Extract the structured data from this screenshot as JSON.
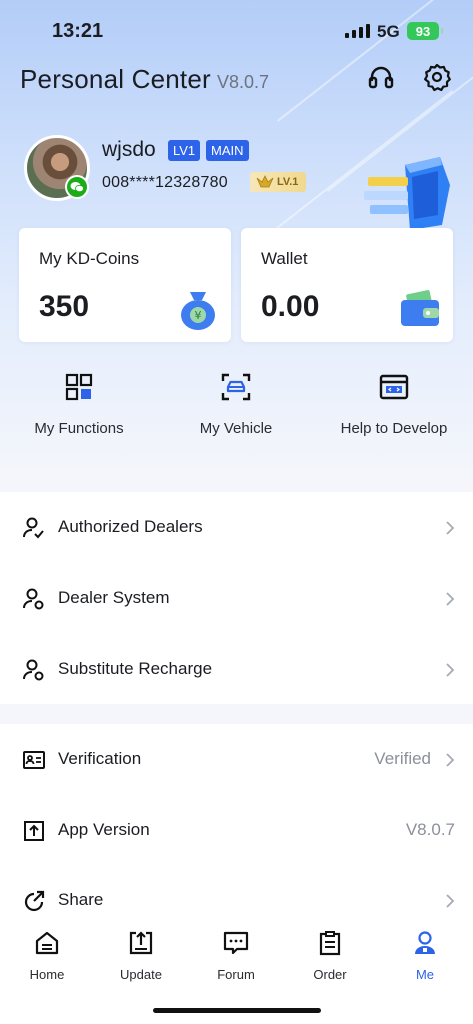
{
  "status": {
    "time": "13:21",
    "network": "5G",
    "battery": "93"
  },
  "header": {
    "title": "Personal Center",
    "version": "V8.0.7"
  },
  "profile": {
    "username": "wjsdo",
    "level_tag": "LV1",
    "account_tag": "MAIN",
    "phone": "008****12328780",
    "vip_level": "LV.1"
  },
  "cards": {
    "coins": {
      "label": "My KD-Coins",
      "value": "350"
    },
    "wallet": {
      "label": "Wallet",
      "value": "0.00"
    }
  },
  "quick": [
    {
      "label": "My Functions",
      "icon": "grid-icon"
    },
    {
      "label": "My Vehicle",
      "icon": "car-scan-icon"
    },
    {
      "label": "Help to Develop",
      "icon": "code-window-icon"
    }
  ],
  "list1": [
    {
      "label": "Authorized Dealers",
      "icon": "user-check-icon"
    },
    {
      "label": "Dealer System",
      "icon": "user-gear-icon"
    },
    {
      "label": "Substitute Recharge",
      "icon": "user-gear-icon"
    }
  ],
  "list2": [
    {
      "label": "Verification",
      "value": "Verified",
      "icon": "id-card-icon"
    },
    {
      "label": "App Version",
      "value": "V8.0.7",
      "icon": "upload-box-icon"
    },
    {
      "label": "Share",
      "value": "",
      "icon": "share-icon"
    }
  ],
  "tabs": [
    {
      "label": "Home",
      "icon": "home-icon"
    },
    {
      "label": "Update",
      "icon": "update-icon"
    },
    {
      "label": "Forum",
      "icon": "forum-icon"
    },
    {
      "label": "Order",
      "icon": "order-icon"
    },
    {
      "label": "Me",
      "icon": "me-icon"
    }
  ],
  "colors": {
    "accent": "#2c63e8",
    "battery": "#34c759",
    "wechat": "#1aad19"
  }
}
